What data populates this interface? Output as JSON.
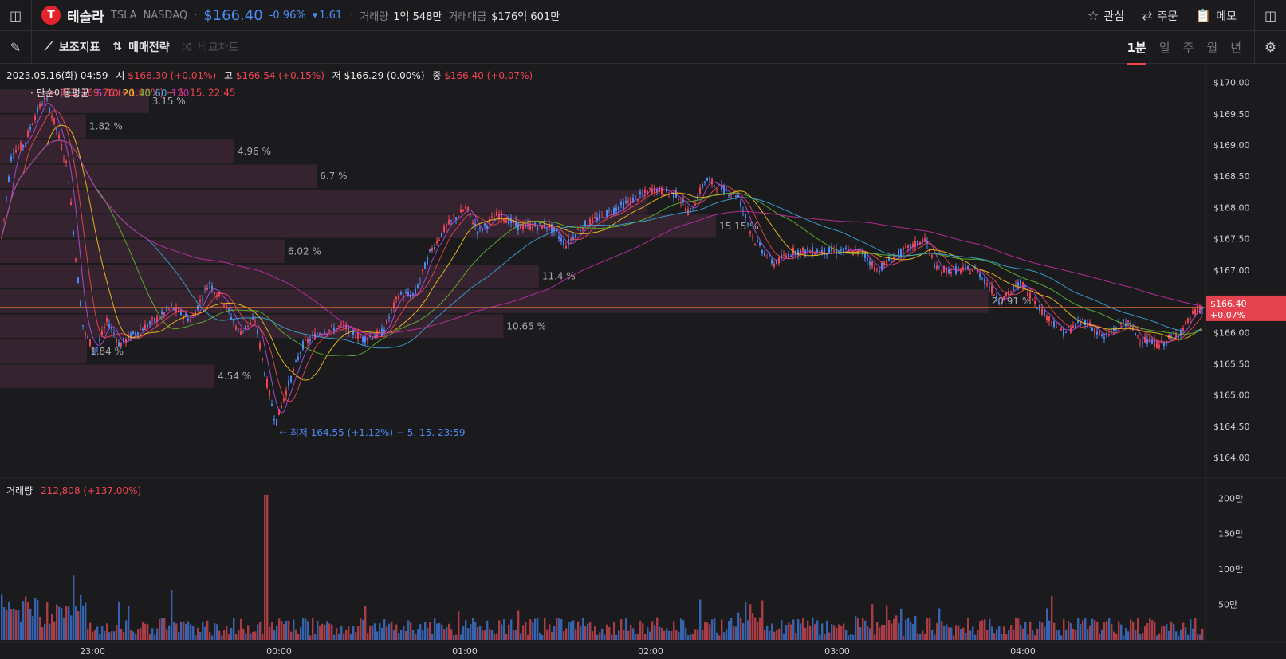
{
  "header": {
    "logo_letter": "T",
    "name": "테슬라",
    "ticker": "TSLA",
    "exchange": "NASDAQ",
    "price": "$166.40",
    "change_pct": "-0.96%",
    "change_amt": "1.61",
    "volume_label": "거래량",
    "volume_value": "1억 548만",
    "amount_label": "거래대금",
    "amount_value": "$176억 601만",
    "buttons": {
      "watch": "관심",
      "order": "주문",
      "memo": "메모"
    }
  },
  "toolbar": {
    "indicators": "보조지표",
    "strategy": "매매전략",
    "compare": "비교차트",
    "periods": [
      "1분",
      "일",
      "주",
      "월",
      "년"
    ],
    "active_period": "1분"
  },
  "ohlc_info": {
    "date": "2023.05.16(화) 04:59",
    "open_label": "시",
    "open": "$166.30 (+0.01%)",
    "high_label": "고",
    "high": "$166.54 (+0.15%)",
    "low_label": "저",
    "low": "$166.29 (0.00%)",
    "close_label": "종",
    "close": "$166.40 (+0.07%)"
  },
  "ma_legend": {
    "label": "· 단순이동평균",
    "periods": [
      "5",
      "10",
      "20",
      "40",
      "60",
      "120"
    ],
    "colors": [
      "#b04be0",
      "#f04452",
      "#f5c518",
      "#5fb830",
      "#3aa6d9",
      "#c42ea0"
    ]
  },
  "annotations": {
    "high": "← 최고 169.76 (−1.98%) − 5. 15. 22:45",
    "low": "← 최저 164.55 (+1.12%) − 5. 15. 23:59"
  },
  "current_price_tag": {
    "price": "$166.40",
    "change": "+0.07%"
  },
  "volume_info": {
    "label": "거래량",
    "value": "212,808 (+137.00%)"
  },
  "chart_data": {
    "type": "candlestick",
    "price_axis_ticks": [
      "$170.00",
      "$169.50",
      "$169.00",
      "$168.50",
      "$168.00",
      "$167.50",
      "$167.00",
      "$166.50",
      "$166.00",
      "$165.50",
      "$165.00",
      "$164.50",
      "$164.00"
    ],
    "price_ylim": [
      164.0,
      170.0
    ],
    "volume_axis_ticks": [
      "200만",
      "150만",
      "100만",
      "50만"
    ],
    "time_ticks": [
      "23:00",
      "00:00",
      "01:00",
      "02:00",
      "03:00",
      "04:00"
    ],
    "volume_profile": [
      {
        "range": [
          169.5,
          169.9
        ],
        "pct": "3.15 %",
        "value": 3.15
      },
      {
        "range": [
          169.1,
          169.5
        ],
        "pct": "1.82 %",
        "value": 1.82
      },
      {
        "range": [
          168.7,
          169.1
        ],
        "pct": "4.96 %",
        "value": 4.96
      },
      {
        "range": [
          168.3,
          168.7
        ],
        "pct": "6.7 %",
        "value": 6.7
      },
      {
        "range": [
          167.9,
          168.3
        ],
        "pct": "",
        "value": 13.7
      },
      {
        "range": [
          167.5,
          167.9
        ],
        "pct": "15.15 %",
        "value": 15.15
      },
      {
        "range": [
          167.1,
          167.5
        ],
        "pct": "6.02 %",
        "value": 6.02
      },
      {
        "range": [
          166.7,
          167.1
        ],
        "pct": "11.4 %",
        "value": 11.4
      },
      {
        "range": [
          166.3,
          166.7
        ],
        "pct": "20.91 %",
        "value": 20.91
      },
      {
        "range": [
          165.9,
          166.3
        ],
        "pct": "10.65 %",
        "value": 10.65
      },
      {
        "range": [
          165.5,
          165.9
        ],
        "pct": "1.84 %",
        "value": 1.84
      },
      {
        "range": [
          165.1,
          165.5
        ],
        "pct": "4.54 %",
        "value": 4.54
      }
    ],
    "price_path": [
      [
        0,
        167.3
      ],
      [
        15,
        168.9
      ],
      [
        30,
        169.0
      ],
      [
        45,
        169.5
      ],
      [
        57,
        169.76
      ],
      [
        70,
        169.3
      ],
      [
        85,
        168.6
      ],
      [
        95,
        167.2
      ],
      [
        105,
        166.0
      ],
      [
        120,
        165.7
      ],
      [
        135,
        166.2
      ],
      [
        150,
        165.8
      ],
      [
        170,
        166.0
      ],
      [
        195,
        166.2
      ],
      [
        215,
        166.4
      ],
      [
        240,
        166.2
      ],
      [
        262,
        166.8
      ],
      [
        280,
        166.5
      ],
      [
        300,
        166.0
      ],
      [
        320,
        166.2
      ],
      [
        333,
        165.3
      ],
      [
        346,
        164.55
      ],
      [
        360,
        165.1
      ],
      [
        380,
        165.8
      ],
      [
        400,
        166.0
      ],
      [
        430,
        166.1
      ],
      [
        455,
        165.9
      ],
      [
        480,
        166.0
      ],
      [
        500,
        166.6
      ],
      [
        520,
        166.6
      ],
      [
        540,
        167.3
      ],
      [
        560,
        167.7
      ],
      [
        585,
        168.0
      ],
      [
        600,
        167.6
      ],
      [
        625,
        167.9
      ],
      [
        650,
        167.7
      ],
      [
        690,
        167.7
      ],
      [
        710,
        167.4
      ],
      [
        730,
        167.7
      ],
      [
        760,
        167.9
      ],
      [
        790,
        168.1
      ],
      [
        820,
        168.3
      ],
      [
        850,
        168.2
      ],
      [
        865,
        167.9
      ],
      [
        885,
        168.45
      ],
      [
        905,
        168.3
      ],
      [
        925,
        168.2
      ],
      [
        945,
        167.5
      ],
      [
        970,
        167.1
      ],
      [
        995,
        167.3
      ],
      [
        1030,
        167.3
      ],
      [
        1060,
        167.3
      ],
      [
        1080,
        167.3
      ],
      [
        1100,
        167.0
      ],
      [
        1120,
        167.2
      ],
      [
        1160,
        167.5
      ],
      [
        1175,
        167.0
      ],
      [
        1200,
        167.0
      ],
      [
        1225,
        167.0
      ],
      [
        1255,
        166.5
      ],
      [
        1280,
        166.8
      ],
      [
        1310,
        166.3
      ],
      [
        1335,
        166.0
      ],
      [
        1360,
        166.2
      ],
      [
        1385,
        165.9
      ],
      [
        1410,
        166.2
      ],
      [
        1430,
        165.9
      ],
      [
        1455,
        165.8
      ],
      [
        1480,
        166.0
      ],
      [
        1500,
        166.35
      ],
      [
        1512,
        166.4
      ]
    ]
  }
}
